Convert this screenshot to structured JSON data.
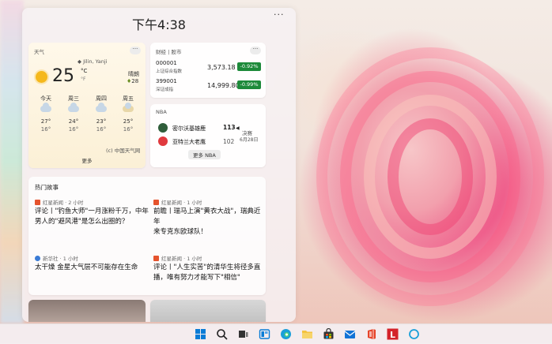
{
  "clock": {
    "time": "下午4:38"
  },
  "panel": {
    "menu": "···"
  },
  "weather": {
    "title": "天气",
    "location": "Jilin, Yanji",
    "temp": "25",
    "unit_c": "°C",
    "unit_f": "°F",
    "condition": "晴朗",
    "aqi": "28",
    "forecast": [
      {
        "day": "今天",
        "high": "27°",
        "low": "16°"
      },
      {
        "day": "周三",
        "high": "24°",
        "low": "16°"
      },
      {
        "day": "周四",
        "high": "23°",
        "low": "16°"
      },
      {
        "day": "周五",
        "high": "25°",
        "low": "16°"
      }
    ],
    "source": "(c) 中国天气网",
    "more": "更多",
    "menu": "···"
  },
  "stock": {
    "title": "财经 | 股市",
    "menu": "···",
    "items": [
      {
        "code": "000001",
        "name": "上证综合指数",
        "price": "3,573.18",
        "change": "-0.92%"
      },
      {
        "code": "399001",
        "name": "深证成指",
        "price": "14,999.80",
        "change": "-0.99%"
      }
    ]
  },
  "nba": {
    "title": "NBA",
    "team1": "密尔沃基雄鹿",
    "score1": "113",
    "team2": "亚特兰大老鹰",
    "score2": "102",
    "status": "决赛",
    "date": "6月28日",
    "more": "更多 NBA"
  },
  "news": {
    "title": "热门故事",
    "items": [
      {
        "source": "红星新闻 · 2 小时",
        "title_l1": "评论丨\"钓鱼大师\"一月涨粉千万，中年",
        "title_l2": "男人的\"避风港\"是怎么出圈的？"
      },
      {
        "source": "红星新闻 · 1 小时",
        "title_l1": "前瞻丨瑞马上演\"黄衣大战\"，瑞典近年",
        "title_l2": "来专克东欧球队！"
      },
      {
        "source": "新华社 · 1 小时",
        "title_l1": "太干燥 金星大气层不可能存在生命",
        "title_l2": ""
      },
      {
        "source": "红星新闻 · 1 小时",
        "title_l1": "评论丨\"人生实苦\"的清华生将径多直",
        "title_l2": "播，唯有努力才能写下\"相信\""
      }
    ]
  },
  "colors": {
    "stock_down": "#1d8a3a",
    "accent": "#0067c0"
  },
  "taskbar": {
    "icons": [
      "windows-start-icon",
      "search-icon",
      "task-view-icon",
      "widgets-icon",
      "edge-icon",
      "file-explorer-icon",
      "store-icon",
      "mail-icon",
      "office-icon",
      "app-l-icon",
      "cortana-icon"
    ]
  }
}
